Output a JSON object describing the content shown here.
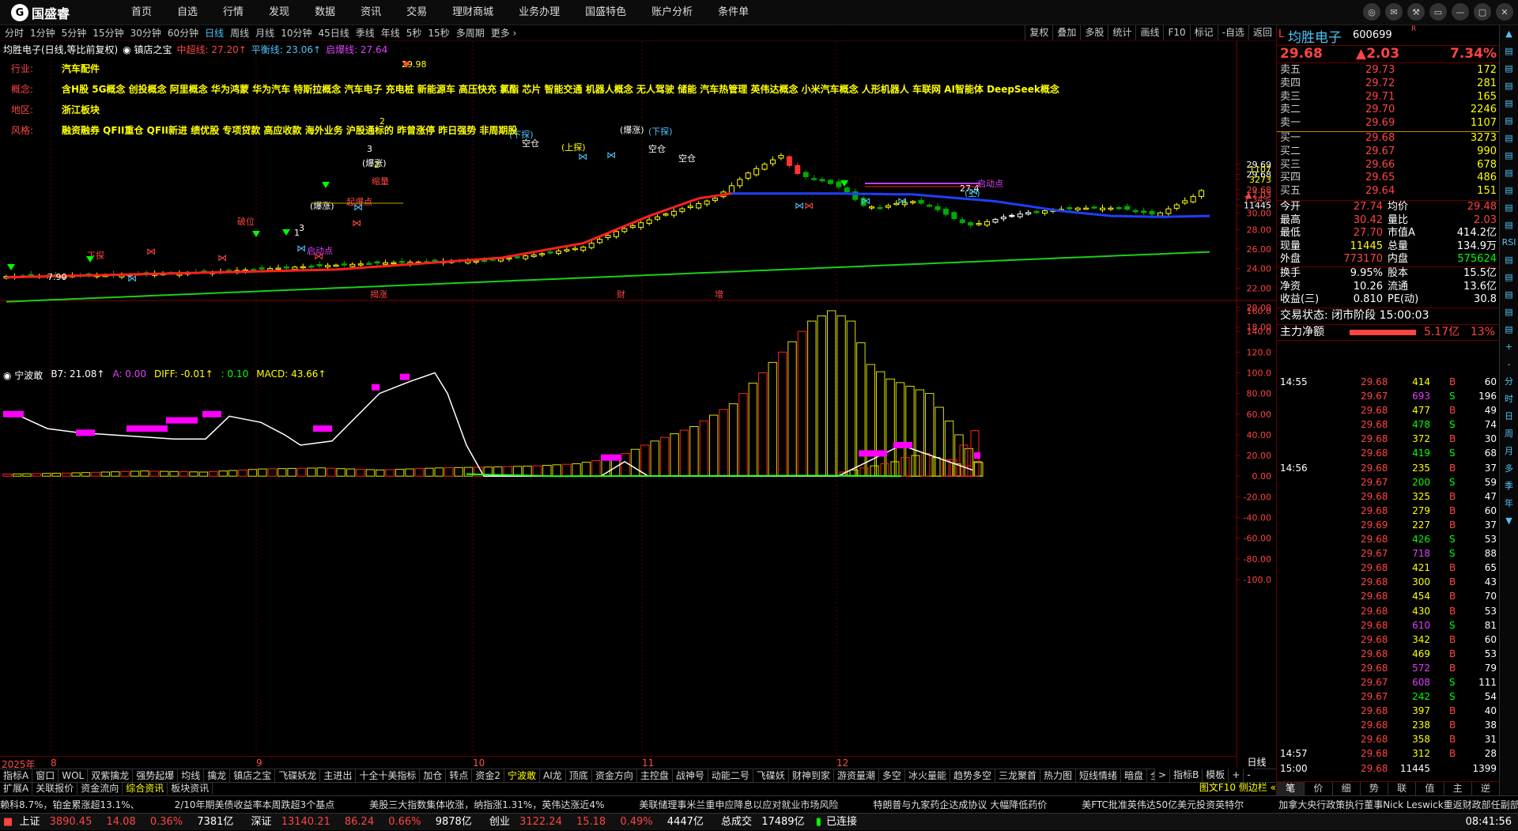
{
  "app": {
    "name": "国盛睿"
  },
  "nav": [
    "首页",
    "自选",
    "行情",
    "发现",
    "数据",
    "资讯",
    "交易",
    "理财商城",
    "业务办理",
    "国盛特色",
    "账户分析",
    "条件单"
  ],
  "winbtns": [
    "◎",
    "✉",
    "⚒",
    "▭",
    "—",
    "▢",
    "✕"
  ],
  "periods": [
    "分时",
    "1分钟",
    "5分钟",
    "15分钟",
    "30分钟",
    "60分钟",
    "日线",
    "周线",
    "月线",
    "10分钟",
    "45日线",
    "季线",
    "年线",
    "5秒",
    "15秒",
    "多周期",
    "更多 ›"
  ],
  "active_period": "日线",
  "tools": [
    "复权",
    "叠加",
    "多股",
    "统计",
    "画线",
    "F10",
    "标记",
    "-自选",
    "返回"
  ],
  "legend1": {
    "title": "均胜电子(日线,等比前复权)",
    "indicator": "镇店之宝",
    "l1": "中超线: 27.20↑",
    "l2": "平衡线: 23.06↑",
    "l3": "启爆线: 27.64"
  },
  "info": [
    {
      "label": "行业:",
      "value": "汽车配件"
    },
    {
      "label": "概念:",
      "value": "含H股 5G概念 创投概念 阿里概念 华为鸿蒙 华为汽车 特斯拉概念 汽车电子 充电桩 新能源车 高压快充 氯酯 芯片 智能交通 机器人概念 无人驾驶 储能 汽车热管理 英伟达概念 小米汽车概念 人形机器人 车联网 AI智能体 DeepSeek概念"
    },
    {
      "label": "地区:",
      "value": "浙江板块"
    },
    {
      "label": "风格:",
      "value": "融资融券 QFII重仓 QFII新进 绩优股 专项贷款 高应收款 海外业务 沪股通标的 昨曾涨停 昨日强势 非周期股"
    }
  ],
  "legend2": {
    "name": "宁波敢",
    "b7": "B7: 21.08↑",
    "a": "A: 0.00",
    "diff": "DIFF: -0.01↑",
    "c": ": 0.10",
    "macd": "MACD: 43.66↑"
  },
  "chart_data": [
    {
      "type": "candlestick",
      "title": "均胜电子(日线,等比前复权)",
      "y_ticks": [
        "29.69",
        "29.68",
        "28.00",
        "30.00",
        "26.00",
        "24.00",
        "22.00",
        "20.00",
        "18.00"
      ],
      "y_labels": [
        {
          "text": "29.69",
          "color": "#ffffff",
          "y": 29.69
        },
        {
          "text": "1107",
          "color": "#ffff00",
          "y": 29.2
        },
        {
          "text": "29.68",
          "color": "#ffffff",
          "y": 28.65
        },
        {
          "text": "3273",
          "color": "#ffff00",
          "y": 28.15
        },
        {
          "text": "29.68",
          "color": "#ff4444",
          "y": 27.1
        },
        {
          "text": "▲2.03",
          "color": "#ff4444",
          "y": 26.6
        },
        {
          "text": "7.34%",
          "color": "#ff4444",
          "y": 26.1
        },
        {
          "text": "11445",
          "color": "#ffffff",
          "y": 25.5
        },
        {
          "text": "30.00",
          "color": "#ff4444",
          "y": 24.7
        },
        {
          "text": "28.00",
          "color": "#ff4444",
          "y": 23.0
        },
        {
          "text": "26.00",
          "color": "#ff4444",
          "y": 21.0
        },
        {
          "text": "24.00",
          "color": "#ff4444",
          "y": 19.0
        },
        {
          "text": "22.00",
          "color": "#ff4444",
          "y": 17.0
        },
        {
          "text": "20.00",
          "color": "#ff4444",
          "y": 15.0
        },
        {
          "text": "18.00",
          "color": "#ff4444",
          "y": 13.0
        }
      ],
      "marks_text": [
        "下探",
        "1",
        "3",
        "2",
        "3",
        "2",
        "启动点",
        "起爆点",
        "缩量",
        "破位",
        "(爆涨)",
        "(爆涨)",
        "(下探)",
        "(上探)",
        "(爆涨)",
        "(下探)",
        "空仓",
        "空仓",
        "空仓",
        "(上)",
        "启动点",
        "29.98",
        "7.90",
        "27.4"
      ],
      "x_labels": [
        "2025年",
        "8",
        "9",
        "10",
        "11",
        "12"
      ],
      "mid_labels": [
        "揭涨",
        "财",
        "增"
      ]
    },
    {
      "type": "bar",
      "title": "宁波敢",
      "y_ticks": [
        "160.0",
        "140.0",
        "120.0",
        "100.0",
        "80.00",
        "60.00",
        "40.00",
        "20.00",
        "0.00",
        "-20.00",
        "-40.00",
        "-60.00",
        "-80.00",
        "-100.0"
      ],
      "ylim": [
        -100,
        160
      ]
    }
  ],
  "x_axis_right": "日线",
  "indicator_tabs": [
    "指标A",
    "窗口",
    "WOL",
    "双紫擒龙",
    "强势起爆",
    "均线",
    "擒龙",
    "镇店之宝",
    "飞碟妖龙",
    "主进出",
    "十全十美指标",
    "加仓",
    "转点",
    "资金2",
    "宁波敢",
    "AI龙",
    "顶底",
    "资金方向",
    "主控盘",
    "战神号",
    "动能二号",
    "飞碟妖",
    "财神到家",
    "游资量潮",
    "多空",
    "冰火量能",
    "趋势多空",
    "三龙聚首",
    "热力图",
    "短线情绪",
    "暗盘",
    "全仓买"
  ],
  "indicator_tabs_active": "宁波敢",
  "indicator_tabs_right": [
    ">",
    "指标B",
    "模板",
    "+",
    "-"
  ],
  "sub_tabs": [
    "扩展A",
    "关联报价",
    "资金流向",
    "综合资讯",
    "板块资讯"
  ],
  "sub_tabs_active": "综合资讯",
  "sub_right": "图文F10 侧边栏 «",
  "news": [
    "赖科8.7%，铂金累涨超13.1%、",
    "2/10年期美债收益率本周跌超3个基点",
    "美股三大指数集体收涨，纳指涨1.31%，英伟达涨近4%",
    "美联储理事米兰重申应降息以应对就业市场风险",
    "特朗普与九家药企达成协议 大幅降低药价",
    "美FTC批准英伟达50亿美元投资英特尔",
    "加拿大央行政策执行董事Nick Leswick重返财政部任副部长"
  ],
  "status": {
    "sh_label": "上证",
    "sh_val": "3890.45",
    "sh_chg": "14.08",
    "sh_pct": "0.36%",
    "sh_amt": "7381亿",
    "sz_label": "深证",
    "sz_val": "13140.21",
    "sz_chg": "86.24",
    "sz_pct": "0.66%",
    "sz_amt": "9878亿",
    "cy_label": "创业",
    "cy_val": "3122.24",
    "cy_chg": "15.18",
    "cy_pct": "0.49%",
    "cy_amt": "4447亿",
    "total_label": "总成交",
    "total_val": "17489亿",
    "conn": "已连接",
    "time": "08:41:56"
  },
  "quote": {
    "name": "均胜电子",
    "code": "600699",
    "rz": "R",
    "price": "29.68",
    "change": "▲2.03",
    "pct": "7.34%",
    "asks": [
      {
        "l": "卖五",
        "p": "29.73",
        "v": "172"
      },
      {
        "l": "卖四",
        "p": "29.72",
        "v": "281"
      },
      {
        "l": "卖三",
        "p": "29.71",
        "v": "165"
      },
      {
        "l": "卖二",
        "p": "29.70",
        "v": "2246"
      },
      {
        "l": "卖一",
        "p": "29.69",
        "v": "1107"
      }
    ],
    "bids": [
      {
        "l": "买一",
        "p": "29.68",
        "v": "3273"
      },
      {
        "l": "买二",
        "p": "29.67",
        "v": "990"
      },
      {
        "l": "买三",
        "p": "29.66",
        "v": "678"
      },
      {
        "l": "买四",
        "p": "29.65",
        "v": "486"
      },
      {
        "l": "买五",
        "p": "29.64",
        "v": "151"
      }
    ],
    "stats": [
      [
        "今开",
        "27.74",
        "均价",
        "29.48"
      ],
      [
        "最高",
        "30.42",
        "量比",
        "2.03"
      ],
      [
        "最低",
        "27.70",
        "市值A",
        "414.2亿"
      ],
      [
        "现量",
        "11445",
        "总量",
        "134.9万"
      ],
      [
        "外盘",
        "773170",
        "内盘",
        "575624"
      ]
    ],
    "stats2": [
      [
        "换手",
        "9.95%",
        "股本",
        "15.5亿"
      ],
      [
        "净资",
        "10.26",
        "流通",
        "13.6亿"
      ],
      [
        "收益(三)",
        "0.810",
        "PE(动)",
        "30.8"
      ]
    ],
    "trade_state": "交易状态: 闭市阶段 15:00:03",
    "main_flow_label": "主力净额",
    "main_flow_val": "5.17亿",
    "main_flow_pct": "13%",
    "ticks": [
      {
        "t": "14:55",
        "p": "29.68",
        "v": "414",
        "s": "B",
        "n": "60"
      },
      {
        "t": "",
        "p": "29.67",
        "v": "693",
        "s": "S",
        "n": "196"
      },
      {
        "t": "",
        "p": "29.68",
        "v": "477",
        "s": "B",
        "n": "49"
      },
      {
        "t": "",
        "p": "29.68",
        "v": "478",
        "s": "S",
        "n": "74"
      },
      {
        "t": "",
        "p": "29.68",
        "v": "372",
        "s": "B",
        "n": "30"
      },
      {
        "t": "",
        "p": "29.68",
        "v": "419",
        "s": "S",
        "n": "68"
      },
      {
        "t": "14:56",
        "p": "29.68",
        "v": "235",
        "s": "B",
        "n": "37"
      },
      {
        "t": "",
        "p": "29.67",
        "v": "200",
        "s": "S",
        "n": "59"
      },
      {
        "t": "",
        "p": "29.68",
        "v": "325",
        "s": "B",
        "n": "47"
      },
      {
        "t": "",
        "p": "29.68",
        "v": "279",
        "s": "B",
        "n": "60"
      },
      {
        "t": "",
        "p": "29.69",
        "v": "227",
        "s": "B",
        "n": "37"
      },
      {
        "t": "",
        "p": "29.68",
        "v": "426",
        "s": "S",
        "n": "53"
      },
      {
        "t": "",
        "p": "29.67",
        "v": "718",
        "s": "S",
        "n": "88"
      },
      {
        "t": "",
        "p": "29.68",
        "v": "421",
        "s": "B",
        "n": "65"
      },
      {
        "t": "",
        "p": "29.68",
        "v": "300",
        "s": "B",
        "n": "43"
      },
      {
        "t": "",
        "p": "29.68",
        "v": "454",
        "s": "B",
        "n": "70"
      },
      {
        "t": "",
        "p": "29.68",
        "v": "430",
        "s": "B",
        "n": "53"
      },
      {
        "t": "",
        "p": "29.68",
        "v": "610",
        "s": "S",
        "n": "81"
      },
      {
        "t": "",
        "p": "29.68",
        "v": "342",
        "s": "B",
        "n": "60"
      },
      {
        "t": "",
        "p": "29.68",
        "v": "469",
        "s": "B",
        "n": "53"
      },
      {
        "t": "",
        "p": "29.68",
        "v": "572",
        "s": "B",
        "n": "79"
      },
      {
        "t": "",
        "p": "29.67",
        "v": "608",
        "s": "S",
        "n": "111"
      },
      {
        "t": "",
        "p": "29.67",
        "v": "242",
        "s": "S",
        "n": "54"
      },
      {
        "t": "",
        "p": "29.68",
        "v": "397",
        "s": "B",
        "n": "40"
      },
      {
        "t": "",
        "p": "29.68",
        "v": "238",
        "s": "B",
        "n": "38"
      },
      {
        "t": "",
        "p": "29.68",
        "v": "358",
        "s": "B",
        "n": "31"
      },
      {
        "t": "14:57",
        "p": "29.68",
        "v": "312",
        "s": "B",
        "n": "28"
      },
      {
        "t": "15:00",
        "p": "29.68",
        "v": "11445",
        "s": "",
        "n": "1399"
      }
    ],
    "rtabs": [
      "笔",
      "价",
      "细",
      "势",
      "联",
      "值",
      "主",
      "逆"
    ],
    "rtabs_active": "笔"
  },
  "side": [
    "▲",
    "▤",
    "▤",
    "▤",
    "▤",
    "▤",
    "▤",
    "▤",
    "▤",
    "▤",
    "▤",
    "▤",
    "RSI",
    "▤",
    "▤",
    "▤",
    "▤",
    "▤",
    "+",
    "-",
    "分",
    "时",
    "日",
    "周",
    "月",
    "多",
    "季",
    "年",
    "▼"
  ]
}
